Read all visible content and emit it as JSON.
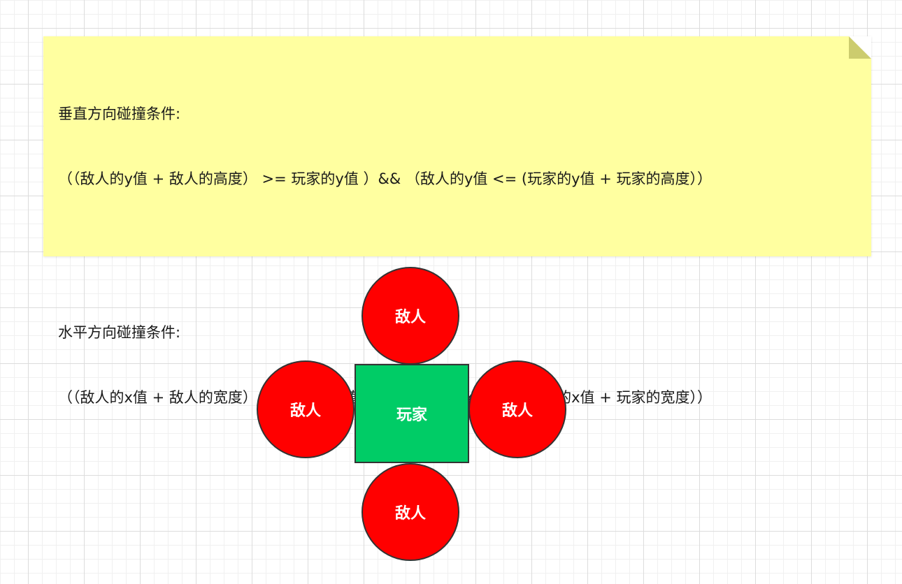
{
  "note": {
    "vertical_title": "垂直方向碰撞条件:",
    "vertical_condition": "（（敌人的y值 + 敌人的高度） >= 玩家的y值 ）&& （敌人的y值 <= (玩家的y值 + 玩家的高度））",
    "horizontal_title": "水平方向碰撞条件:",
    "horizontal_condition": "（（敌人的x值 + 敌人的宽度） >= 玩家的x值 ）&& （敌人的x值 <= (玩家的x值 + 玩家的宽度））"
  },
  "diagram": {
    "enemy_top_label": "敌人",
    "enemy_left_label": "敌人",
    "enemy_right_label": "敌人",
    "enemy_bottom_label": "敌人",
    "player_label": "玩家"
  },
  "colors": {
    "note_background": "#ffffa0",
    "enemy_fill": "#ff0000",
    "player_fill": "#00cc66",
    "stroke": "#333333"
  }
}
